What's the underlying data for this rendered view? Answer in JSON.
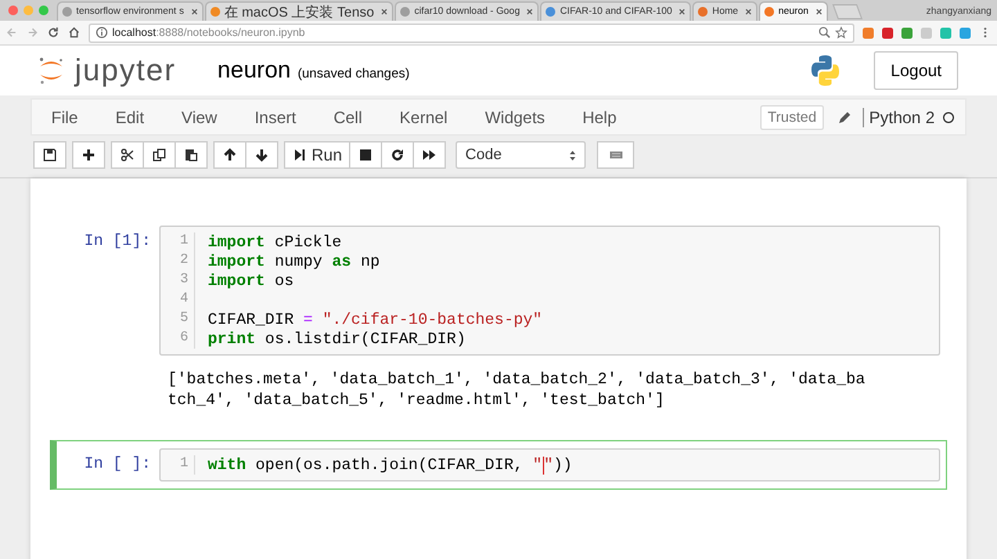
{
  "browser": {
    "tabs": [
      {
        "title": "tensorflow environment s",
        "color": "#9e9e9e",
        "selected": false
      },
      {
        "title": "在 macOS 上安装 Tenso",
        "color": "#f08a24",
        "selected": false
      },
      {
        "title": "cifar10 download - Goog",
        "color": "#9e9e9e",
        "selected": false
      },
      {
        "title": "CIFAR-10 and CIFAR-100",
        "color": "#4a90d9",
        "selected": false
      },
      {
        "title": "Home",
        "color": "#e8702a",
        "selected": false
      },
      {
        "title": "neuron",
        "color": "#f37726",
        "selected": true
      }
    ],
    "profile": "zhangyanxiang",
    "address": {
      "host": "localhost",
      "path": ":8888/notebooks/neuron.ipynb"
    }
  },
  "header": {
    "logo_text": "jupyter",
    "notebook_name": "neuron",
    "save_status": "(unsaved changes)",
    "logout": "Logout"
  },
  "menu": [
    "File",
    "Edit",
    "View",
    "Insert",
    "Cell",
    "Kernel",
    "Widgets",
    "Help"
  ],
  "trusted": "Trusted",
  "kernel": {
    "name": "Python 2",
    "busy": false
  },
  "toolbar": {
    "run": "Run",
    "cell_type": "Code"
  },
  "cells": [
    {
      "prompt": "In [1]:",
      "selected": false,
      "lines": [
        {
          "number": "1",
          "tokens": [
            {
              "kind": "keyword",
              "text": "import"
            },
            {
              "kind": "name",
              "text": " cPickle"
            }
          ]
        },
        {
          "number": "2",
          "tokens": [
            {
              "kind": "keyword",
              "text": "import"
            },
            {
              "kind": "name",
              "text": " numpy "
            },
            {
              "kind": "keyword",
              "text": "as"
            },
            {
              "kind": "name",
              "text": " np"
            }
          ]
        },
        {
          "number": "3",
          "tokens": [
            {
              "kind": "keyword",
              "text": "import"
            },
            {
              "kind": "name",
              "text": " os"
            }
          ]
        },
        {
          "number": "4"
        },
        {
          "number": "5",
          "tokens": [
            {
              "kind": "name",
              "text": "CIFAR_DIR "
            },
            {
              "kind": "operator",
              "text": "="
            },
            {
              "kind": "string",
              "text": " \"./cifar-10-batches-py\""
            }
          ]
        },
        {
          "number": "6",
          "tokens": [
            {
              "kind": "keyword",
              "text": "print"
            },
            {
              "kind": "name",
              "text": " os.listdir(CIFAR_DIR)"
            }
          ]
        }
      ],
      "output": [
        "['batches.meta', 'data_batch_1', 'data_batch_2', 'data_batch_3', 'data_ba",
        "tch_4', 'data_batch_5', 'readme.html', 'test_batch']"
      ]
    },
    {
      "prompt": "In [ ]:",
      "selected": true,
      "lines": [
        {
          "number": "1",
          "tokens": [
            {
              "kind": "keyword",
              "text": "with"
            },
            {
              "kind": "name",
              "text": " open(os.path.join(CIFAR_DIR, "
            },
            {
              "kind": "string",
              "text": "\""
            },
            {
              "kind": "string",
              "text": "\"",
              "cursor_before": true
            },
            {
              "kind": "name",
              "text": "))"
            }
          ]
        }
      ]
    }
  ]
}
